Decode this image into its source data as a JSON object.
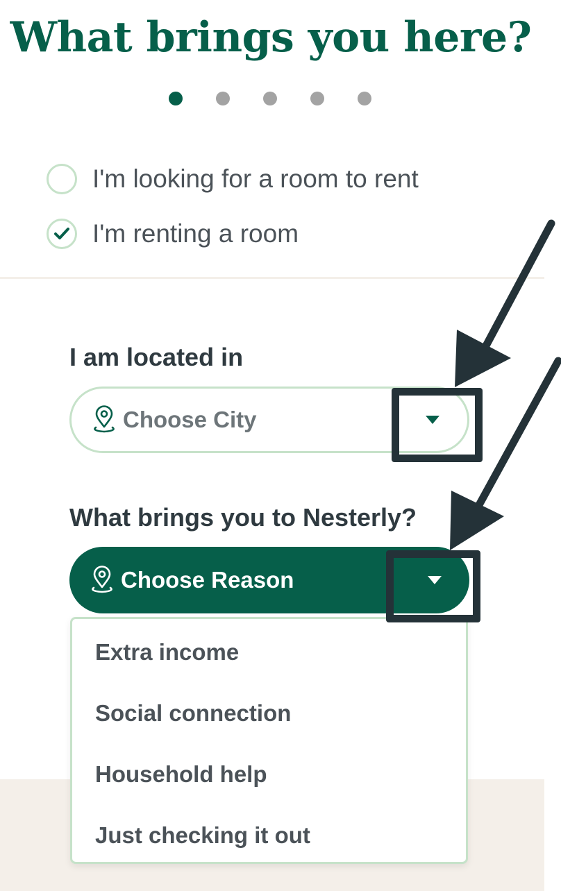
{
  "page": {
    "title": "What brings you here?"
  },
  "progress": {
    "total_steps": 5,
    "current_step": 1
  },
  "role_options": [
    {
      "label": "I'm looking for a room to rent",
      "checked": false
    },
    {
      "label": "I'm renting a room",
      "checked": true
    }
  ],
  "location": {
    "label": "I am located in",
    "placeholder": "Choose City",
    "icon": "map-pin-icon",
    "caret_icon": "caret-down-icon"
  },
  "reason": {
    "label": "What brings you to Nesterly?",
    "placeholder": "Choose Reason",
    "icon": "map-pin-icon",
    "caret_icon": "caret-down-icon",
    "expanded": true,
    "options": [
      "Extra income",
      "Social connection",
      "Household help",
      "Just checking it out"
    ]
  },
  "colors": {
    "brand_green": "#065f4a",
    "light_green_border": "#c6e2c9",
    "beige": "#f4efe9",
    "annotation": "#243238",
    "inactive_dot": "#a3a3a3"
  }
}
